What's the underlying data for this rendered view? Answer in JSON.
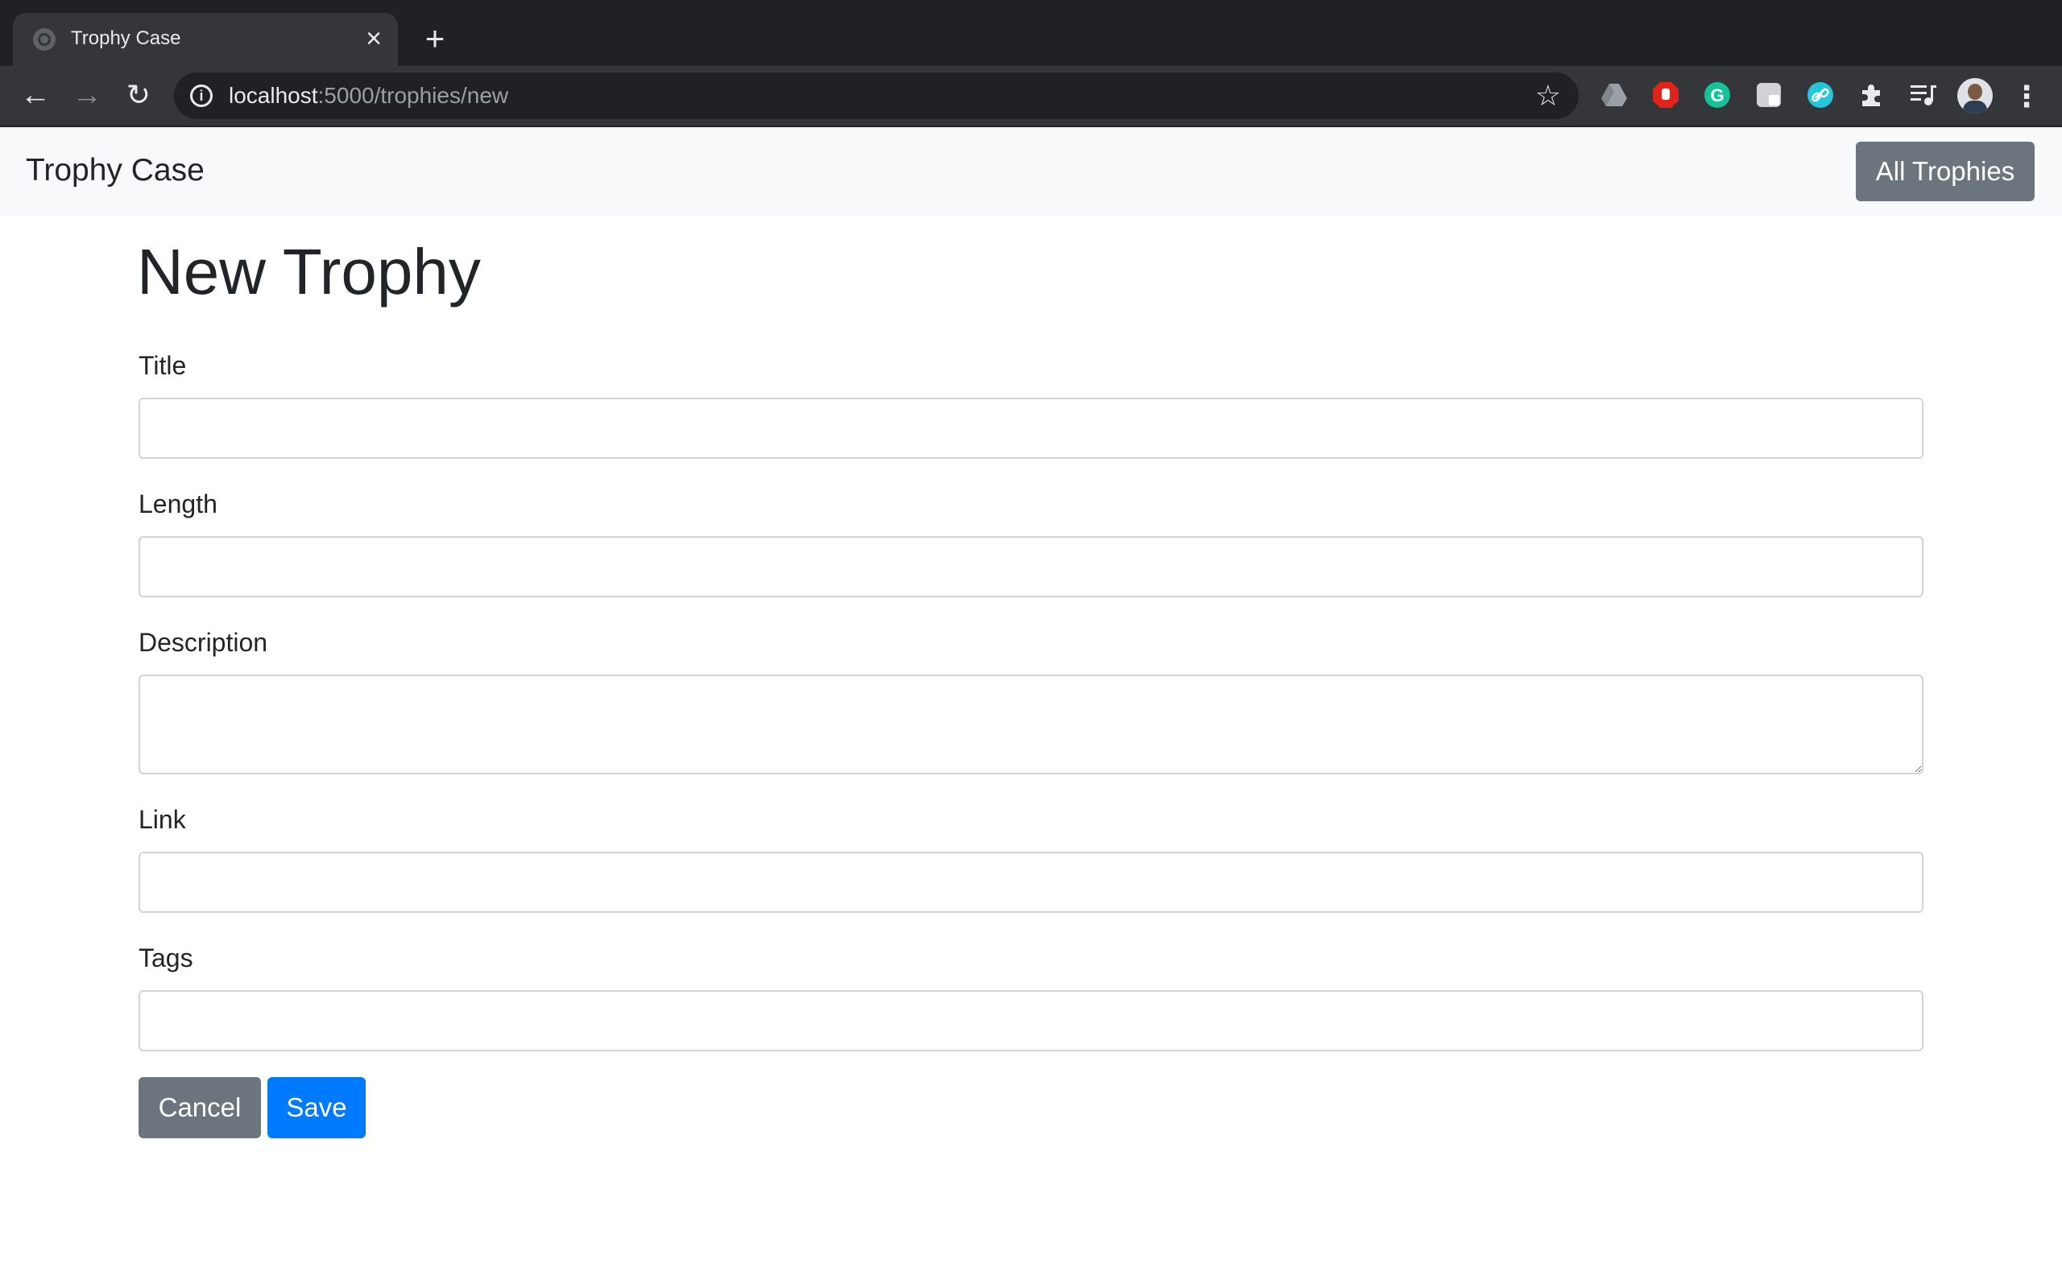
{
  "browser": {
    "tab_title": "Trophy Case",
    "url_host": "localhost",
    "url_path": ":5000/trophies/new"
  },
  "extensions": [
    {
      "name": "google-drive-icon",
      "color": "#9aa0a6"
    },
    {
      "name": "adblock-icon",
      "color": "#e2231a"
    },
    {
      "name": "grammarly-icon",
      "color": "#15c39a"
    },
    {
      "name": "notion-icon",
      "color": "#d0d2d6"
    },
    {
      "name": "link-icon",
      "color": "#26c6da"
    },
    {
      "name": "extensions-puzzle-icon",
      "color": "#e8eaed"
    },
    {
      "name": "media-queue-icon",
      "color": "#e8eaed"
    }
  ],
  "navbar": {
    "brand": "Trophy Case",
    "all_trophies_label": "All Trophies"
  },
  "form": {
    "heading": "New Trophy",
    "fields": [
      {
        "label": "Title",
        "value": ""
      },
      {
        "label": "Length",
        "value": ""
      },
      {
        "label": "Description",
        "value": ""
      },
      {
        "label": "Link",
        "value": ""
      },
      {
        "label": "Tags",
        "value": ""
      }
    ],
    "cancel_label": "Cancel",
    "save_label": "Save"
  },
  "colors": {
    "primary": "#007bff",
    "secondary": "#6c757d",
    "navbar_bg": "#f8f9fa"
  }
}
